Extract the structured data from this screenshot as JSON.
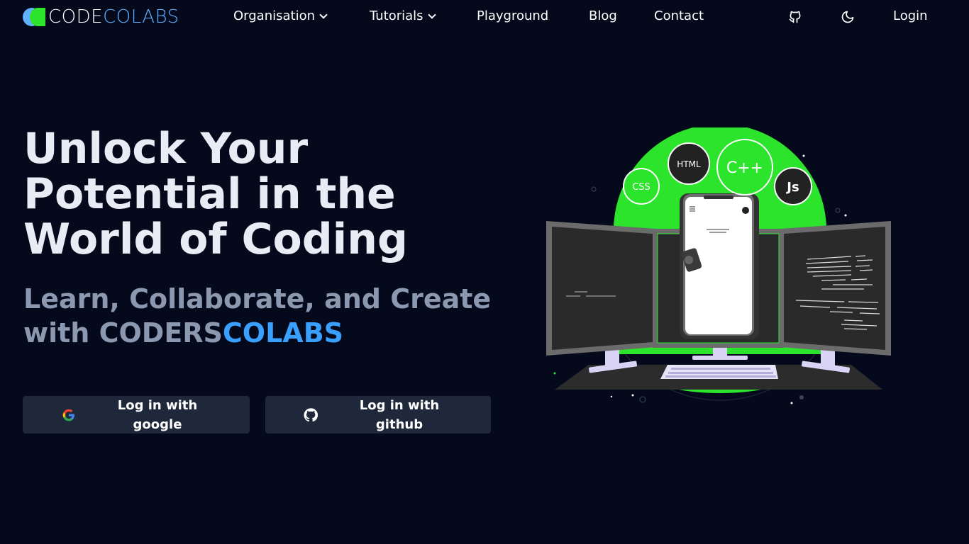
{
  "brand": {
    "part1": "CODE",
    "part2": "COLABS"
  },
  "nav": {
    "organisation": "Organisation",
    "tutorials": "Tutorials",
    "playground": "Playground",
    "blog": "Blog",
    "contact": "Contact",
    "login": "Login",
    "icons": [
      "github-icon",
      "moon-icon",
      "chevron-down-icon"
    ]
  },
  "hero": {
    "title": "Unlock Your Potential in the World of Coding",
    "subtitle_prefix": "Learn, Collaborate, and Create with CODERS",
    "subtitle_highlight": "COLABS"
  },
  "buttons": {
    "google": "Log in with\ngoogle",
    "github": "Log in with\ngithub",
    "icons": [
      "google-icon",
      "github-icon"
    ]
  },
  "illustration": {
    "badges": [
      "CSS",
      "HTML",
      "C++",
      "Js"
    ]
  },
  "colors": {
    "background": "#040A1C",
    "accent_blue": "#3AA0FF",
    "accent_green": "#2BE42B",
    "button_bg": "#1E283A"
  }
}
